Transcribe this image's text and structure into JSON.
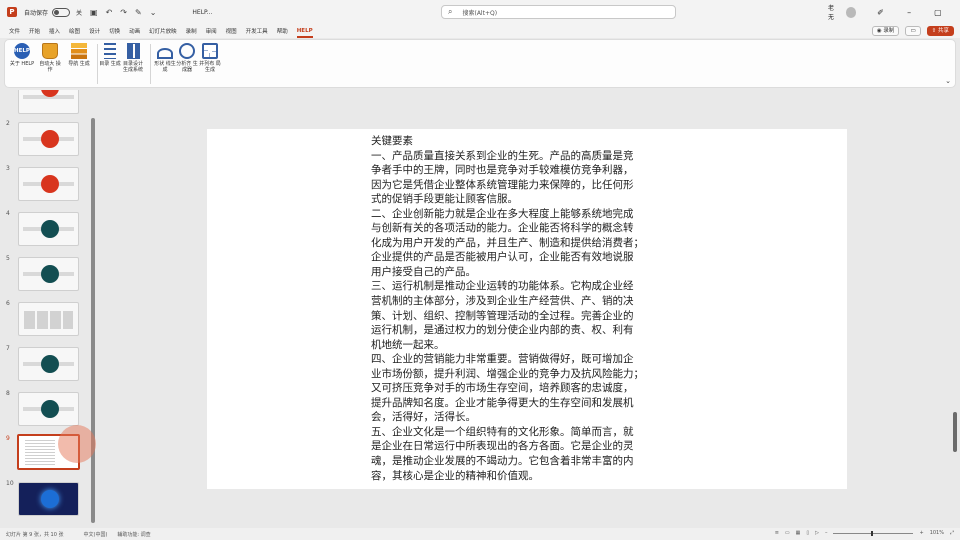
{
  "titlebar": {
    "logo": "P",
    "autosave_label": "自动保存",
    "toggle_state": "关",
    "file_name": "HELP...",
    "search_placeholder": "搜索(Alt+Q)",
    "user_name": "老无"
  },
  "menu": {
    "items": [
      "文件",
      "开始",
      "插入",
      "绘图",
      "设计",
      "切换",
      "动画",
      "幻灯片放映",
      "录制",
      "审阅",
      "视图",
      "开发工具",
      "帮助",
      "HELP"
    ],
    "active": "HELP",
    "present_label": "◉ 录制",
    "comment_label": "▭",
    "share_label": "⇧ 共享"
  },
  "ribbon": {
    "buttons": [
      {
        "label": "关于 HELP",
        "icon": "help-icon"
      },
      {
        "label": "自动大 操作",
        "icon": "cup-icon"
      },
      {
        "label": "导航 生成",
        "icon": "stack-icon"
      },
      {
        "label": "目录 生成",
        "icon": "lines-icon"
      },
      {
        "label": "目录设计 生成系统",
        "icon": "grid-icon"
      },
      {
        "label": "形状 线生成",
        "icon": "wave-icon"
      },
      {
        "label": "分析齐 生成器",
        "icon": "cycle-icon"
      },
      {
        "label": "并列布 局生成",
        "icon": "quad-icon"
      }
    ]
  },
  "thumbnails": [
    {
      "num": "",
      "style": "red"
    },
    {
      "num": "2",
      "style": "red"
    },
    {
      "num": "3",
      "style": "red"
    },
    {
      "num": "4",
      "style": "teal"
    },
    {
      "num": "5",
      "style": "teal"
    },
    {
      "num": "6",
      "style": "cells"
    },
    {
      "num": "7",
      "style": "teal"
    },
    {
      "num": "8",
      "style": "teal"
    },
    {
      "num": "9",
      "style": "text"
    },
    {
      "num": "10",
      "style": "dark"
    }
  ],
  "selected_slide": "9",
  "slide": {
    "lines": [
      "关键要素",
      "一、产品质量直接关系到企业的生死。产品的高质量是竞",
      "争者手中的王牌，同时也是竞争对手较难模仿竞争利器，",
      "因为它是凭借企业整体系统管理能力来保障的，比任何形",
      "式的促销手段更能让顾客信服。",
      "二、企业创新能力就是企业在多大程度上能够系统地完成",
      "与创新有关的各项活动的能力。企业能否将科学的概念转",
      "化成为用户开发的产品，并且生产、制造和提供给消费者；",
      "企业提供的产品是否能被用户认可，企业能否有效地说服",
      "用户接受自己的产品。",
      "三、运行机制是推动企业运转的功能体系。它构成企业经",
      "营机制的主体部分，涉及到企业生产经营供、产、销的决",
      "策、计划、组织、控制等管理活动的全过程。完善企业的",
      "运行机制，是通过权力的划分使企业内部的责、权、利有",
      "机地统一起来。",
      "四、企业的营销能力非常重要。营销做得好，既可增加企",
      "业市场份额，提升利润、增强企业的竞争力及抗风险能力；",
      "又可挤压竞争对手的市场生存空间，培养顾客的忠诚度，",
      "提升品牌知名度。企业才能争得更大的生存空间和发展机",
      "会，活得好，活得长。",
      "五、企业文化是一个组织特有的文化形象。简单而言，就",
      "是企业在日常运行中所表现出的各方各面。它是企业的灵",
      "魂，是推动企业发展的不竭动力。它包含着非常丰富的内",
      "容，其核心是企业的精神和价值观。"
    ]
  },
  "statusbar": {
    "slide_info": "幻灯片 第 9 张，共 10 张",
    "language": "中文(中国)",
    "accessibility": "辅助功能: 调查",
    "zoom": "101%"
  }
}
